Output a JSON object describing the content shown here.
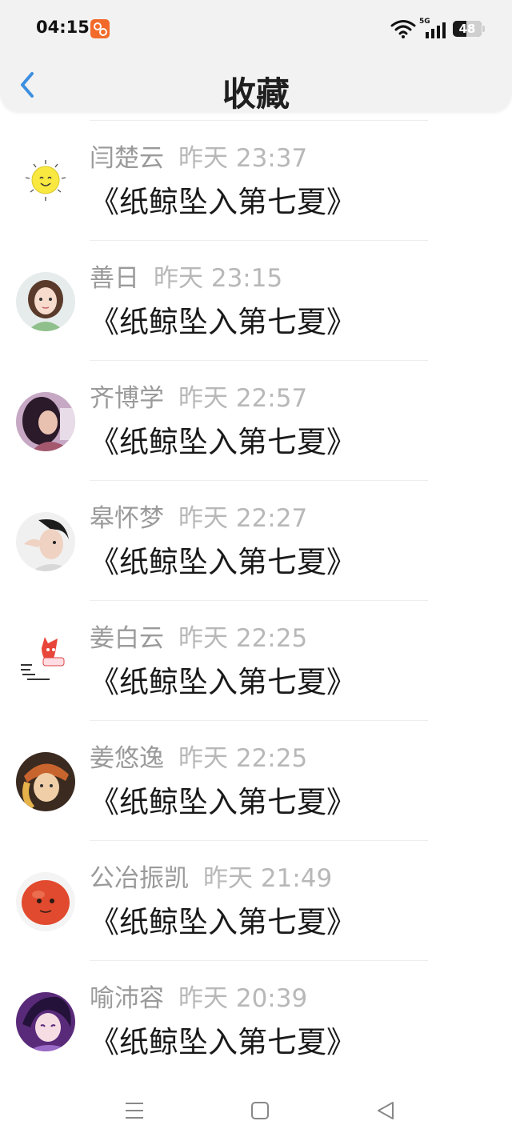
{
  "status_bar": {
    "time": "04:15",
    "network": "5G",
    "battery": "48",
    "battery_level_percent": 48,
    "app_icon": "orange-app-icon"
  },
  "header": {
    "back_icon": "chevron-left-icon",
    "title": "收藏"
  },
  "items": [
    {
      "name": "闫楚云",
      "time": "昨天 23:37",
      "title": "《纸鲸坠入第七夏》",
      "avatar": "sun-sticker"
    },
    {
      "name": "善日",
      "time": "昨天 23:15",
      "title": "《纸鲸坠入第七夏》",
      "avatar": "girl-portrait"
    },
    {
      "name": "齐博学",
      "time": "昨天 22:57",
      "title": "《纸鲸坠入第七夏》",
      "avatar": "woman-dark-hair"
    },
    {
      "name": "皋怀梦",
      "time": "昨天 22:27",
      "title": "《纸鲸坠入第七夏》",
      "avatar": "man-portrait"
    },
    {
      "name": "姜白云",
      "time": "昨天 22:25",
      "title": "《纸鲸坠入第七夏》",
      "avatar": "fox-sticker"
    },
    {
      "name": "姜悠逸",
      "time": "昨天 22:25",
      "title": "《纸鲸坠入第七夏》",
      "avatar": "woman-headscarf"
    },
    {
      "name": "公冶振凯",
      "time": "昨天 21:49",
      "title": "《纸鲸坠入第七夏》",
      "avatar": "red-blob"
    },
    {
      "name": "喻沛容",
      "time": "昨天 20:39",
      "title": "《纸鲸坠入第七夏》",
      "avatar": "anime-character"
    }
  ],
  "nav_bar": {
    "menu_icon": "menu-icon",
    "home_icon": "home-square-icon",
    "back_icon": "back-triangle-icon"
  },
  "colors": {
    "accent": "#3d8fe0",
    "app_icon": "#f26a2a",
    "header_bg": "#f2f2f2",
    "name_text": "#9a9a9a",
    "time_text": "#b8b8b8"
  }
}
